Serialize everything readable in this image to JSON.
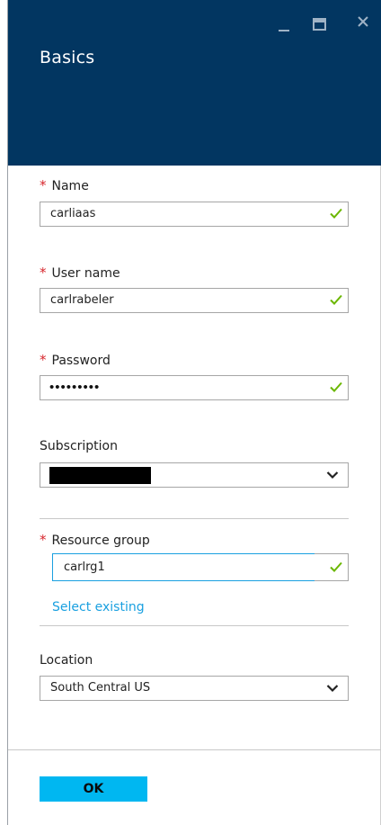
{
  "window": {
    "title": "Basics",
    "controls": [
      "minimize-icon",
      "maximize-icon",
      "close-icon"
    ]
  },
  "form": {
    "name": {
      "label": "Name",
      "required": true,
      "value": "carliaas",
      "valid": true
    },
    "username": {
      "label": "User name",
      "required": true,
      "value": "carlrabeler",
      "valid": true
    },
    "password": {
      "label": "Password",
      "required": true,
      "masked_value": "•••••••••",
      "valid": true
    },
    "subscription": {
      "label": "Subscription",
      "value_redacted": true
    },
    "resource_group": {
      "label": "Resource group",
      "required": true,
      "value": "carlrg1",
      "valid": true,
      "link": "Select existing"
    },
    "location": {
      "label": "Location",
      "value": "South Central US"
    }
  },
  "footer": {
    "ok_label": "OK"
  },
  "colors": {
    "header_bg": "#023661",
    "required_star": "#d7262c",
    "valid_check": "#6bb700",
    "link": "#1aa0e0",
    "ok_button": "#00b7f1"
  }
}
